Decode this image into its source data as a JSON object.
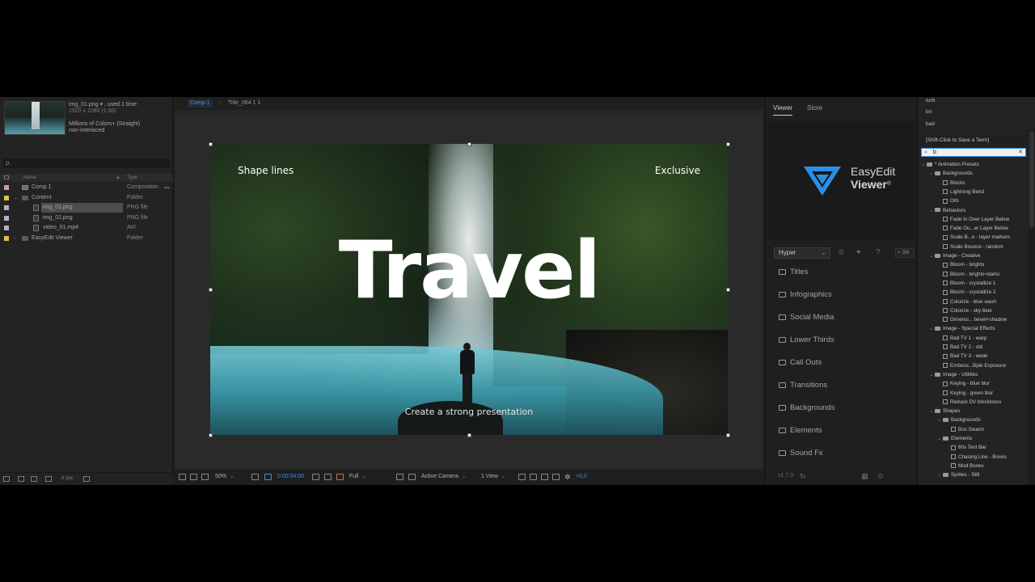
{
  "project": {
    "asset_name": "img_01.png ▾ , used 1 time",
    "asset_dims": "1920 x 1080 (1,00)",
    "asset_colors": "Millions of Colors+ (Straight)",
    "asset_interlace": "non-interlaced",
    "search_placeholder": "ρ.",
    "col_name": "Name",
    "col_type": "Type",
    "items": [
      {
        "name": "Comp 1",
        "type": "Composition",
        "label_color": "#c9a0a0",
        "icon": "comp",
        "indent": 0,
        "arrow": ""
      },
      {
        "name": "Content",
        "type": "Folder",
        "label_color": "#e0c440",
        "icon": "folder",
        "indent": 0,
        "arrow": "⌄"
      },
      {
        "name": "img_01.png",
        "type": "PNG file",
        "label_color": "#b0b0c8",
        "icon": "file",
        "indent": 1,
        "arrow": "",
        "selected": true
      },
      {
        "name": "img_02.png",
        "type": "PNG file",
        "label_color": "#b0b0c8",
        "icon": "file",
        "indent": 1,
        "arrow": ""
      },
      {
        "name": "video_01.mp4",
        "type": "AVI",
        "label_color": "#b0b0c8",
        "icon": "file",
        "indent": 1,
        "arrow": ""
      },
      {
        "name": "EasyEdit Viewer",
        "type": "Folder",
        "label_color": "#e0c440",
        "icon": "folder",
        "indent": 0,
        "arrow": "›"
      }
    ],
    "bpc": "8 bpc"
  },
  "comp": {
    "tab_active": "Comp 1",
    "tab_sep": "‹",
    "tab_other": "Title_064 1 1",
    "canvas_text": {
      "shape": "Shape lines",
      "exclusive": "Exclusive",
      "title": "Travel",
      "subtitle": "Create a strong presentation"
    },
    "bar": {
      "zoom": "50%",
      "timecode": "0:00:04:00",
      "resolution": "Full",
      "camera": "Active Camera",
      "views": "1 View",
      "exposure": "+0,0"
    }
  },
  "viewer": {
    "tab_viewer": "Viewer",
    "tab_store": "Store",
    "logo_line1": "EasyEdit",
    "logo_line2": "Viewer",
    "logo_mark": "®",
    "brand_color": "#2b8fe6",
    "dropdown_value": "Hyper",
    "search_placeholder": "Se",
    "categories": [
      "Titles",
      "Infographics",
      "Social Media",
      "Lower Thirds",
      "Call Outs",
      "Transitions",
      "Backgrounds",
      "Elements",
      "Sound Fx"
    ],
    "version": "v1.7.3"
  },
  "effects": {
    "recent_terms": [
      "turb",
      "bri",
      "bad"
    ],
    "hint": "[Shift-Click to Save a Term]",
    "search_value": "b",
    "tree": [
      {
        "label": "* Animation Presets",
        "level": 0,
        "kind": "folder",
        "open": true
      },
      {
        "label": "Backgrounds",
        "level": 1,
        "kind": "folder",
        "open": true
      },
      {
        "label": "Blocks",
        "level": 2,
        "kind": "preset"
      },
      {
        "label": "Lightning Bend",
        "level": 2,
        "kind": "preset"
      },
      {
        "label": "Orb",
        "level": 2,
        "kind": "preset"
      },
      {
        "label": "Behaviors",
        "level": 1,
        "kind": "folder",
        "open": true
      },
      {
        "label": "Fade In Over Layer Below",
        "level": 2,
        "kind": "preset"
      },
      {
        "label": "Fade Ou...er Layer Below",
        "level": 2,
        "kind": "preset"
      },
      {
        "label": "Scale B...e - layer markers",
        "level": 2,
        "kind": "preset"
      },
      {
        "label": "Scale Bounce - random",
        "level": 2,
        "kind": "preset"
      },
      {
        "label": "Image - Creative",
        "level": 1,
        "kind": "folder",
        "open": true
      },
      {
        "label": "Bloom - brights",
        "level": 2,
        "kind": "preset"
      },
      {
        "label": "Bloom - brights+darks",
        "level": 2,
        "kind": "preset"
      },
      {
        "label": "Bloom - crystallize 1",
        "level": 2,
        "kind": "preset"
      },
      {
        "label": "Bloom - crystallize 2",
        "level": 2,
        "kind": "preset"
      },
      {
        "label": "Colorize - blue wash",
        "level": 2,
        "kind": "preset"
      },
      {
        "label": "Colorize - sky blue",
        "level": 2,
        "kind": "preset"
      },
      {
        "label": "Dimensi... bevel+shadow",
        "level": 2,
        "kind": "preset"
      },
      {
        "label": "Image - Special Effects",
        "level": 1,
        "kind": "folder",
        "open": true
      },
      {
        "label": "Bad TV 1 - warp",
        "level": 2,
        "kind": "preset"
      },
      {
        "label": "Bad TV 2 - old",
        "level": 2,
        "kind": "preset"
      },
      {
        "label": "Bad TV 3 - weak",
        "level": 2,
        "kind": "preset"
      },
      {
        "label": "Emboss...Bple Exposure",
        "level": 2,
        "kind": "preset"
      },
      {
        "label": "Image - Utilities",
        "level": 1,
        "kind": "folder",
        "open": true
      },
      {
        "label": "Keying - blue blur",
        "level": 2,
        "kind": "preset"
      },
      {
        "label": "Keying - green blur",
        "level": 2,
        "kind": "preset"
      },
      {
        "label": "Reduce DV blockiness",
        "level": 2,
        "kind": "preset"
      },
      {
        "label": "Shapes",
        "level": 1,
        "kind": "folder",
        "open": true
      },
      {
        "label": "Backgrounds",
        "level": 2,
        "kind": "folder",
        "open": true
      },
      {
        "label": "Box Swarm",
        "level": 3,
        "kind": "preset"
      },
      {
        "label": "Elements",
        "level": 2,
        "kind": "folder",
        "open": true
      },
      {
        "label": "60s Text Bar",
        "level": 3,
        "kind": "preset"
      },
      {
        "label": "Chasing Line - Boxes",
        "level": 3,
        "kind": "preset"
      },
      {
        "label": "Mod Boxes",
        "level": 3,
        "kind": "preset"
      },
      {
        "label": "Sprites - Still",
        "level": 2,
        "kind": "folder",
        "open": true
      }
    ]
  }
}
